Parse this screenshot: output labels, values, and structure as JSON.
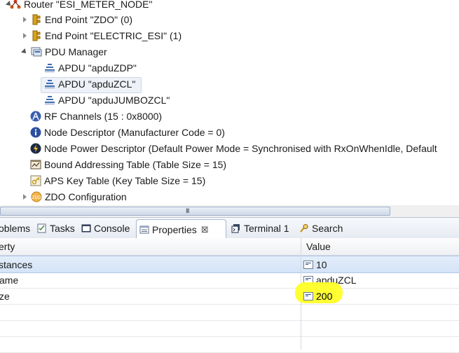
{
  "tree": {
    "items": [
      {
        "label": "Router \"ESI_METER_NODE\"",
        "icon": "router-icon",
        "twisty": "open"
      },
      {
        "label": "End Point \"ZDO\" (0)",
        "icon": "endpoint-icon",
        "twisty": "closed"
      },
      {
        "label": "End Point \"ELECTRIC_ESI\" (1)",
        "icon": "endpoint-icon",
        "twisty": "closed"
      },
      {
        "label": "PDU Manager",
        "icon": "pdu-manager-icon",
        "twisty": "open"
      },
      {
        "label": "APDU \"apduZDP\"",
        "icon": "apdu-icon",
        "twisty": "none"
      },
      {
        "label": "APDU \"apduZCL\"",
        "icon": "apdu-icon",
        "twisty": "none",
        "selected": true
      },
      {
        "label": "APDU \"apduJUMBOZCL\"",
        "icon": "apdu-icon",
        "twisty": "none"
      },
      {
        "label": "RF Channels (15 : 0x8000)",
        "icon": "antenna-icon",
        "twisty": "none"
      },
      {
        "label": "Node Descriptor (Manufacturer Code = 0)",
        "icon": "info-icon",
        "twisty": "none"
      },
      {
        "label": "Node Power Descriptor (Default Power Mode = Synchronised with RxOnWhenIdle, Default",
        "icon": "power-icon",
        "twisty": "none"
      },
      {
        "label": "Bound Addressing Table (Table Size = 15)",
        "icon": "table-icon",
        "twisty": "none"
      },
      {
        "label": "APS Key Table (Key Table Size = 15)",
        "icon": "key-table-icon",
        "twisty": "none"
      },
      {
        "label": "ZDO Configuration",
        "icon": "zdo-icon",
        "twisty": "closed"
      }
    ]
  },
  "tabs": [
    {
      "label": "oblems",
      "icon": "problems-icon"
    },
    {
      "label": "Tasks",
      "icon": "tasks-icon"
    },
    {
      "label": "Console",
      "icon": "console-icon"
    },
    {
      "label": "Properties",
      "icon": "properties-icon",
      "active": true,
      "close": "⊠"
    },
    {
      "label": "Terminal 1",
      "icon": "terminal-icon"
    },
    {
      "label": "Search",
      "icon": "search-icon"
    }
  ],
  "properties": {
    "col_property": "erty",
    "col_value": "Value",
    "rows": [
      {
        "name": "stances",
        "value": "10"
      },
      {
        "name": "ame",
        "value": "apduZCL"
      },
      {
        "name": "ze",
        "value": "200"
      }
    ]
  },
  "colors": {
    "accent": "#3c6db5",
    "highlight": "#ffff26",
    "selection": "#d3e3f7"
  }
}
